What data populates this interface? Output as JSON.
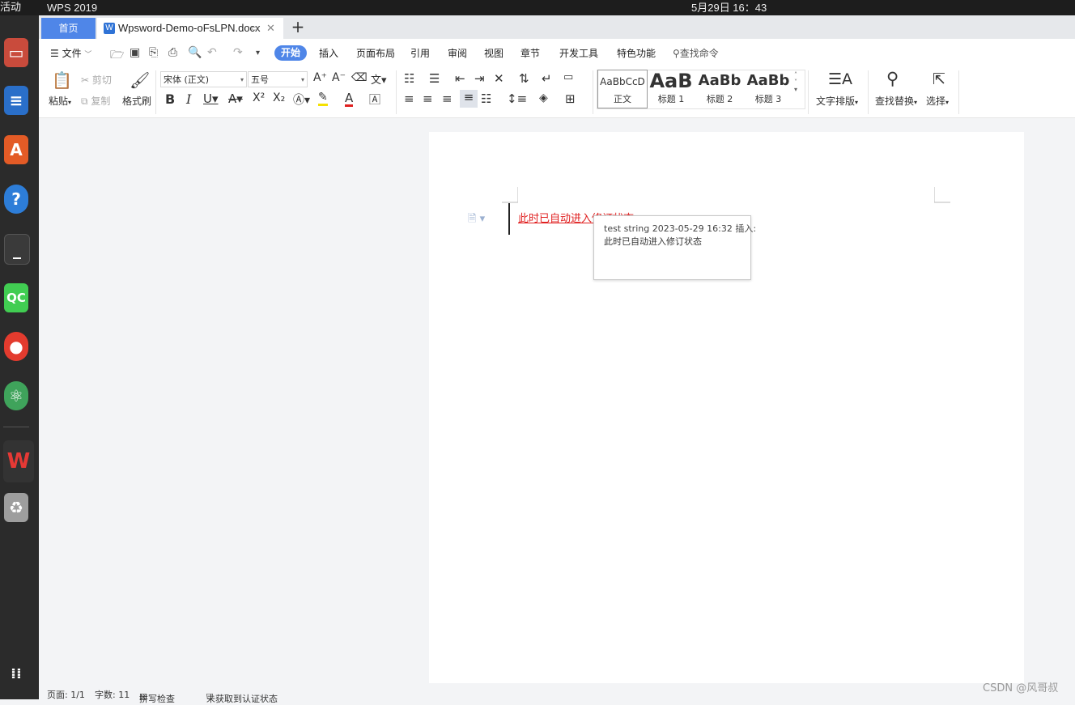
{
  "topbar": {
    "left_text": "活动",
    "app_name": "WPS 2019",
    "clock": "5月29日 16：43"
  },
  "tabs": {
    "home": "首页",
    "doc": "Wpsword-Demo-oFsLPN.docx",
    "add": "+"
  },
  "menu": {
    "file": "文件",
    "items": [
      "开始",
      "插入",
      "页面布局",
      "引用",
      "审阅",
      "视图",
      "章节",
      "开发工具",
      "特色功能"
    ],
    "search": "查找命令"
  },
  "ribbon": {
    "paste": "粘贴",
    "cut": "剪切",
    "copy": "复制",
    "format_painter": "格式刷",
    "font_name": "宋体 (正文)",
    "font_size": "五号",
    "styles": [
      {
        "preview": "AaBbCcD",
        "label": "正文"
      },
      {
        "preview": "AaB",
        "label": "标题 1"
      },
      {
        "preview": "AaBb",
        "label": "标题 2"
      },
      {
        "preview": "AaBb",
        "label": "标题 3"
      }
    ],
    "text_layout": "文字排版",
    "find_replace": "查找替换",
    "select": "选择"
  },
  "document": {
    "revision_text": "此时已自动进入修订状态",
    "comment_header": "test string 2023-05-29 16:32 插入:",
    "comment_body": "此时已自动进入修订状态"
  },
  "status": {
    "page": "页面: 1/1",
    "words": "字数: 11",
    "spell": "拼写检查",
    "auth": "未获取到认证状态"
  },
  "watermark": "CSDN @风哥叔"
}
